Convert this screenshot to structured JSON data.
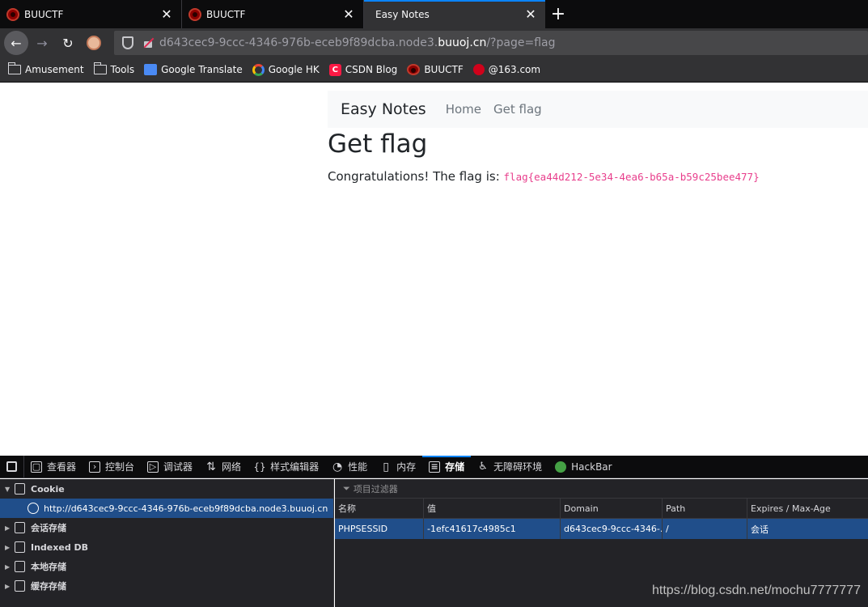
{
  "browser": {
    "tabs": [
      {
        "title": "BUUCTF",
        "active": false,
        "favicon": "buuctf-icon"
      },
      {
        "title": "BUUCTF",
        "active": false,
        "favicon": "buuctf-icon"
      },
      {
        "title": "Easy Notes",
        "active": true,
        "favicon": ""
      }
    ],
    "url_prefix": "d643cec9-9ccc-4346-976b-eceb9f89dcba.node3.",
    "url_host": "buuoj.cn",
    "url_path": "/?page=flag",
    "bookmarks": [
      {
        "label": "Amusement",
        "icon": "folder-icon"
      },
      {
        "label": "Tools",
        "icon": "folder-icon"
      },
      {
        "label": "Google Translate",
        "icon": "google-translate-icon"
      },
      {
        "label": "Google HK",
        "icon": "google-icon"
      },
      {
        "label": "CSDN Blog",
        "icon": "csdn-icon"
      },
      {
        "label": "BUUCTF",
        "icon": "buuctf-icon"
      },
      {
        "label": "@163.com",
        "icon": "netease-icon"
      }
    ]
  },
  "site": {
    "brand": "Easy Notes",
    "nav": [
      "Home",
      "Get flag"
    ],
    "title": "Get flag",
    "message": "Congratulations! The flag is: ",
    "flag": "flag{ea44d212-5e34-4ea6-b65a-b59c25bee477}"
  },
  "devtools": {
    "tabs": [
      {
        "label": "查看器",
        "glyph": "▢"
      },
      {
        "label": "控制台",
        "glyph": "›"
      },
      {
        "label": "调试器",
        "glyph": "▷"
      },
      {
        "label": "网络",
        "glyph": "⇅"
      },
      {
        "label": "样式编辑器",
        "glyph": "{}"
      },
      {
        "label": "性能",
        "glyph": "◔"
      },
      {
        "label": "内存",
        "glyph": "▯"
      },
      {
        "label": "存储",
        "glyph": "≡"
      },
      {
        "label": "无障碍环境",
        "glyph": "♿"
      },
      {
        "label": "HackBar",
        "glyph": ""
      }
    ],
    "active_tab": "存储",
    "tree": {
      "cookie": "Cookie",
      "cookie_host": "http://d643cec9-9ccc-4346-976b-eceb9f89dcba.node3.buuoj.cn",
      "session": "会话存储",
      "indexeddb": "Indexed DB",
      "local": "本地存储",
      "cache": "缓存存储"
    },
    "filter_placeholder": "项目过滤器",
    "columns": [
      "名称",
      "值",
      "Domain",
      "Path",
      "Expires / Max-Age"
    ],
    "rows": [
      [
        "PHPSESSID",
        "-1efc41617c4985c1",
        "d643cec9-9ccc-4346-...",
        "/",
        "会话"
      ]
    ]
  },
  "watermark": "https://blog.csdn.net/mochu7777777"
}
